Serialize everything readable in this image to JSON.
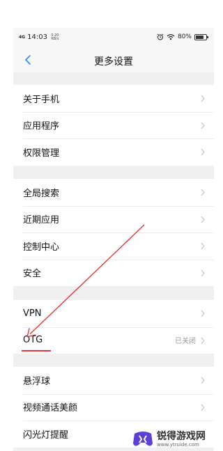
{
  "status_bar": {
    "signal": "4G",
    "time": "14:03",
    "net_speed": "0.20 KB/s",
    "battery": "80%",
    "battery_level": 0.8
  },
  "header": {
    "title": "更多设置"
  },
  "groups": [
    {
      "items": [
        {
          "label": "关于手机"
        },
        {
          "label": "应用程序"
        },
        {
          "label": "权限管理"
        }
      ]
    },
    {
      "items": [
        {
          "label": "全局搜索"
        },
        {
          "label": "近期应用"
        },
        {
          "label": "控制中心"
        },
        {
          "label": "安全"
        }
      ]
    },
    {
      "items": [
        {
          "label": "VPN"
        },
        {
          "label": "OTG",
          "value": "已关闭"
        }
      ]
    },
    {
      "items": [
        {
          "label": "悬浮球"
        },
        {
          "label": "视频通话美颜"
        },
        {
          "label": "闪光灯提醒"
        }
      ]
    }
  ],
  "watermark": {
    "title": "锐得游戏网",
    "url": "www.ytruide.com"
  },
  "colors": {
    "back_arrow": "#2f86ff",
    "annotation": "#e53935"
  }
}
